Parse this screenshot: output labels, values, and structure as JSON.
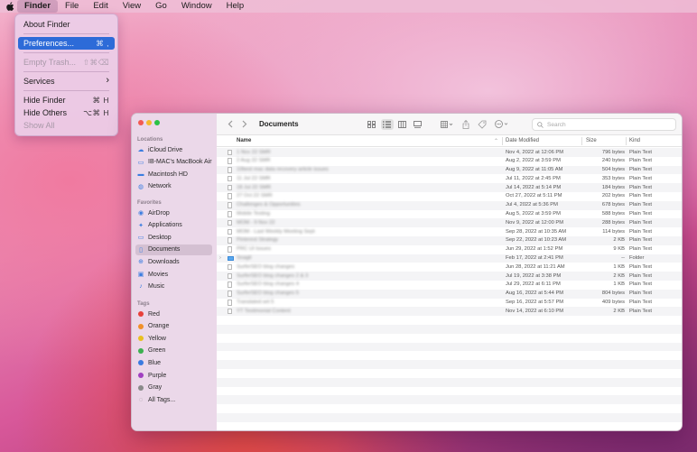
{
  "menubar": {
    "items": [
      "Finder",
      "File",
      "Edit",
      "View",
      "Go",
      "Window",
      "Help"
    ]
  },
  "finder_menu": {
    "about": "About Finder",
    "preferences": "Preferences...",
    "preferences_shortcut": "⌘ ,",
    "empty_trash": "Empty Trash...",
    "empty_trash_shortcut": "⇧⌘⌫",
    "services": "Services",
    "services_arrow": "›",
    "hide_finder": "Hide Finder",
    "hide_finder_shortcut": "⌘ H",
    "hide_others": "Hide Others",
    "hide_others_shortcut": "⌥⌘ H",
    "show_all": "Show All"
  },
  "window": {
    "title": "Documents",
    "search_placeholder": "Search"
  },
  "sidebar": {
    "locations_header": "Locations",
    "locations": [
      {
        "label": "iCloud Drive",
        "icon": "cloud-icon"
      },
      {
        "label": "IB-MAC's MacBook Air",
        "icon": "laptop-icon"
      },
      {
        "label": "Macintosh HD",
        "icon": "disk-icon"
      },
      {
        "label": "Network",
        "icon": "globe-icon"
      }
    ],
    "favorites_header": "Favorites",
    "favorites": [
      {
        "label": "AirDrop",
        "icon": "airdrop-icon"
      },
      {
        "label": "Applications",
        "icon": "applications-icon"
      },
      {
        "label": "Desktop",
        "icon": "desktop-icon"
      },
      {
        "label": "Documents",
        "icon": "document-icon"
      },
      {
        "label": "Downloads",
        "icon": "download-icon"
      },
      {
        "label": "Movies",
        "icon": "movie-icon"
      },
      {
        "label": "Music",
        "icon": "music-icon"
      }
    ],
    "tags_header": "Tags",
    "tags": [
      {
        "label": "Red",
        "color": "#e8403a"
      },
      {
        "label": "Orange",
        "color": "#f0902a"
      },
      {
        "label": "Yellow",
        "color": "#e8c020"
      },
      {
        "label": "Green",
        "color": "#3cb050"
      },
      {
        "label": "Blue",
        "color": "#3a7ae0"
      },
      {
        "label": "Purple",
        "color": "#a040c0"
      },
      {
        "label": "Gray",
        "color": "#8a8a8a"
      },
      {
        "label": "All Tags...",
        "color": ""
      }
    ]
  },
  "columns": {
    "name": "Name",
    "date": "Date Modified",
    "size": "Size",
    "kind": "Kind"
  },
  "files": [
    {
      "name": "1 Nov 22 SMR",
      "date": "Nov 4, 2022 at 12:06 PM",
      "size": "796 bytes",
      "kind": "Plain Text",
      "folder": false
    },
    {
      "name": "2 Aug 22 SMR",
      "date": "Aug 2, 2022 at 3:59 PM",
      "size": "240 bytes",
      "kind": "Plain Text",
      "folder": false
    },
    {
      "name": "10best mac data recovery article issues",
      "date": "Aug 9, 2022 at 11:05 AM",
      "size": "504 bytes",
      "kind": "Plain Text",
      "folder": false
    },
    {
      "name": "11 Jul 22 SMR",
      "date": "Jul 11, 2022 at 2:45 PM",
      "size": "353 bytes",
      "kind": "Plain Text",
      "folder": false
    },
    {
      "name": "18 Jul 22 SMR",
      "date": "Jul 14, 2022 at 5:14 PM",
      "size": "184 bytes",
      "kind": "Plain Text",
      "folder": false
    },
    {
      "name": "27 Oct 22 SMR",
      "date": "Oct 27, 2022 at 5:11 PM",
      "size": "202 bytes",
      "kind": "Plain Text",
      "folder": false
    },
    {
      "name": "Challenges & Opportunities",
      "date": "Jul 4, 2022 at 5:36 PM",
      "size": "678 bytes",
      "kind": "Plain Text",
      "folder": false
    },
    {
      "name": "Mobile Testing",
      "date": "Aug 5, 2022 at 3:59 PM",
      "size": "588 bytes",
      "kind": "Plain Text",
      "folder": false
    },
    {
      "name": "MOM - 9 Nov 22",
      "date": "Nov 9, 2022 at 12:00 PM",
      "size": "288 bytes",
      "kind": "Plain Text",
      "folder": false
    },
    {
      "name": "MOM - Last Weekly Meeting Sept",
      "date": "Sep 28, 2022 at 10:35 AM",
      "size": "114 bytes",
      "kind": "Plain Text",
      "folder": false
    },
    {
      "name": "Pinterest Strategy",
      "date": "Sep 22, 2022 at 10:23 AM",
      "size": "2 KB",
      "kind": "Plain Text",
      "folder": false
    },
    {
      "name": "PRC UI Issues",
      "date": "Jun 29, 2022 at 1:52 PM",
      "size": "9 KB",
      "kind": "Plain Text",
      "folder": false
    },
    {
      "name": "Snagit",
      "date": "Feb 17, 2022 at 2:41 PM",
      "size": "--",
      "kind": "Folder",
      "folder": true
    },
    {
      "name": "SurferSEO blog changes",
      "date": "Jun 28, 2022 at 11:21 AM",
      "size": "1 KB",
      "kind": "Plain Text",
      "folder": false
    },
    {
      "name": "SurferSEO blog changes 2 & 3",
      "date": "Jul 19, 2022 at 3:38 PM",
      "size": "2 KB",
      "kind": "Plain Text",
      "folder": false
    },
    {
      "name": "SurferSEO blog changes 4",
      "date": "Jul 29, 2022 at 6:11 PM",
      "size": "1 KB",
      "kind": "Plain Text",
      "folder": false
    },
    {
      "name": "SurferSEO blog changes 5",
      "date": "Aug 16, 2022 at 5:44 PM",
      "size": "804 bytes",
      "kind": "Plain Text",
      "folder": false
    },
    {
      "name": "Translated set 5",
      "date": "Sep 16, 2022 at 5:57 PM",
      "size": "409 bytes",
      "kind": "Plain Text",
      "folder": false
    },
    {
      "name": "YT Testimonial Content",
      "date": "Nov 14, 2022 at 6:10 PM",
      "size": "2 KB",
      "kind": "Plain Text",
      "folder": false
    }
  ]
}
